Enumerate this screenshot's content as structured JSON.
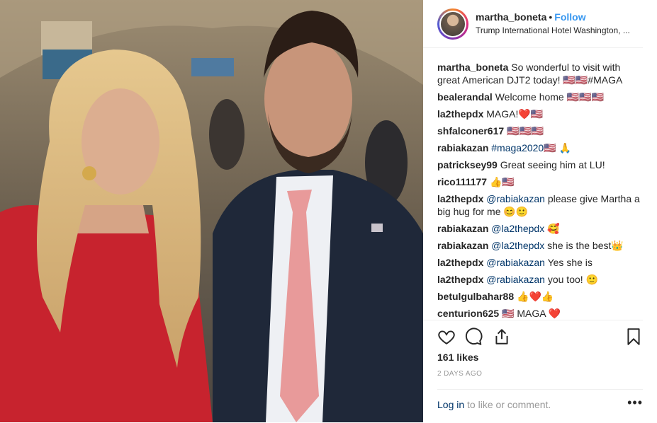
{
  "header": {
    "username": "martha_boneta",
    "separator": "•",
    "follow_label": "Follow",
    "location": "Trump International Hotel Washington, ..."
  },
  "comments": [
    {
      "user": "martha_boneta",
      "text": "So wonderful to visit with great American DJT2 today! 🇺🇸🇺🇸#MAGA"
    },
    {
      "user": "bealerandal",
      "text": "Welcome home 🇺🇸🇺🇸🇺🇸"
    },
    {
      "user": "la2thepdx",
      "text": "MAGA!❤️🇺🇸"
    },
    {
      "user": "shfalconer617",
      "text": "🇺🇸🇺🇸🇺🇸"
    },
    {
      "user": "rabiakazan",
      "text": "#maga2020🇺🇸 🙏"
    },
    {
      "user": "patricksey99",
      "text": "Great seeing him at LU!"
    },
    {
      "user": "rico111177",
      "text": "👍🇺🇸"
    },
    {
      "user": "la2thepdx",
      "mention": "@rabiakazan",
      "text": " please give Martha a big hug for me 😊🙂"
    },
    {
      "user": "rabiakazan",
      "mention": "@la2thepdx",
      "text": " 🥰"
    },
    {
      "user": "rabiakazan",
      "mention": "@la2thepdx",
      "text": " she is the best👑"
    },
    {
      "user": "la2thepdx",
      "mention": "@rabiakazan",
      "text": " Yes she is"
    },
    {
      "user": "la2thepdx",
      "mention": "@rabiakazan",
      "text": " you too! 🙂"
    },
    {
      "user": "betulgulbahar88",
      "text": "👍❤️👍"
    },
    {
      "user": "centurion625",
      "text": "🇺🇸 MAGA ❤️"
    }
  ],
  "actions": {
    "like": "heart-icon",
    "comment": "comment-icon",
    "share": "share-icon",
    "save": "bookmark-icon"
  },
  "likes_text": "161 likes",
  "timestamp": "2 DAYS AGO",
  "footer": {
    "login_label": "Log in",
    "login_suffix": " to like or comment.",
    "more_label": "•••"
  }
}
